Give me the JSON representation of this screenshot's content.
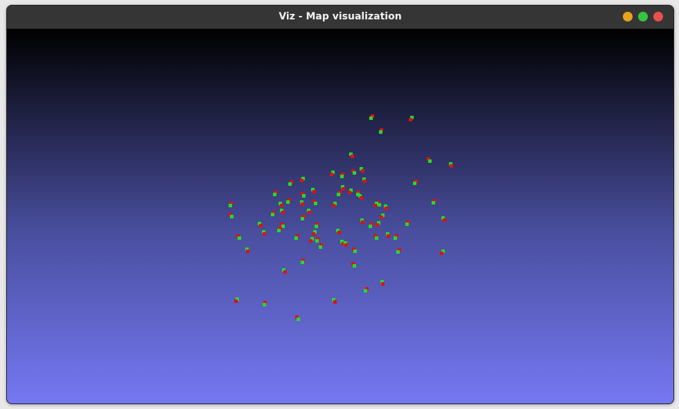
{
  "window": {
    "title": "Viz - Map visualization"
  },
  "controls": {
    "minimize_color": "#e6a41c",
    "maximize_color": "#35c63f",
    "close_color": "#e8504f"
  },
  "viewport": {
    "background_gradient": [
      "#000000",
      "#4a4fa0",
      "#7578f2"
    ],
    "marker_colors": {
      "primary": "#e01010",
      "secondary": "#22dd22"
    }
  }
}
